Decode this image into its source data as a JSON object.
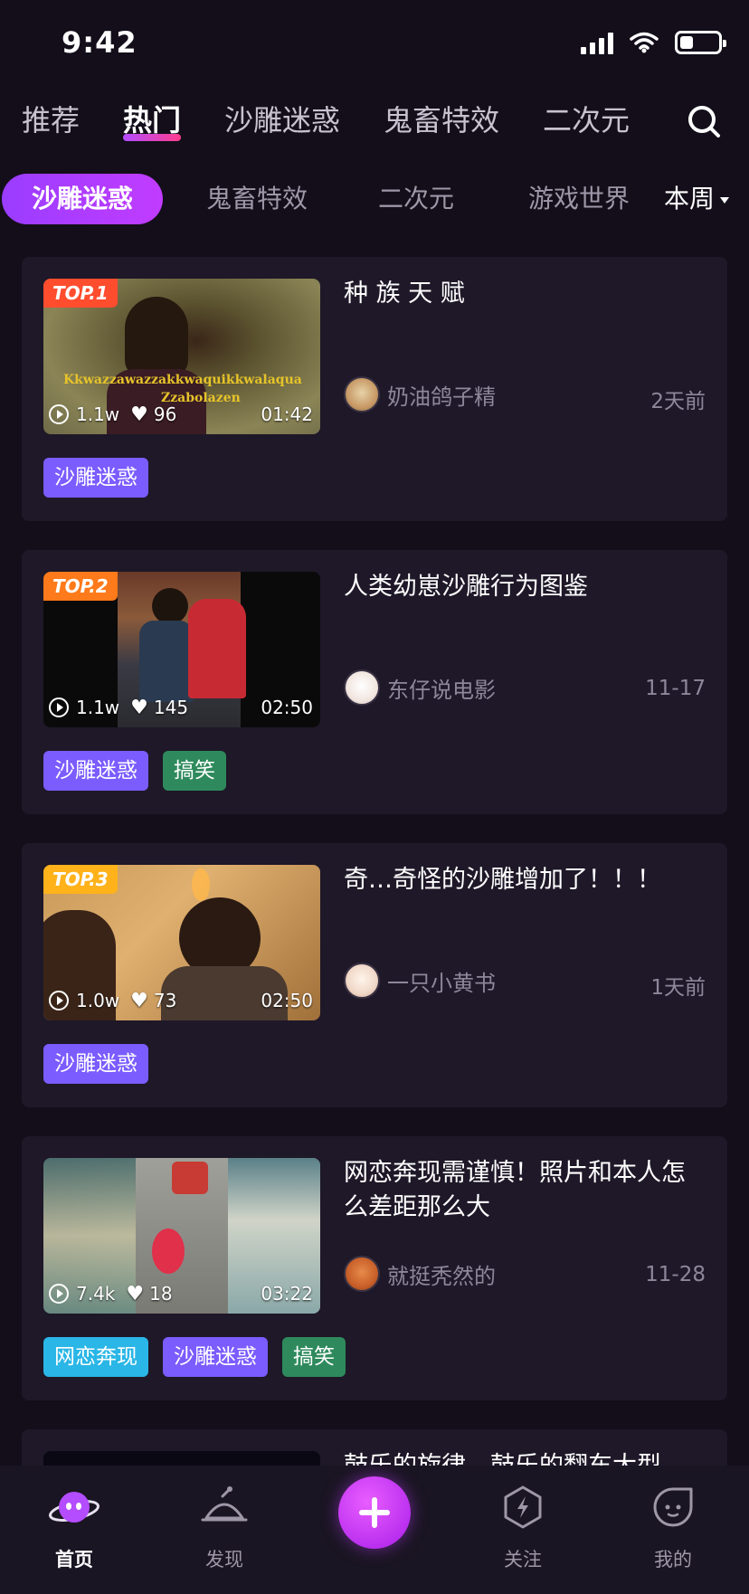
{
  "status_bar": {
    "time": "9:42"
  },
  "top_tabs": [
    {
      "label": "推荐"
    },
    {
      "label": "热门"
    },
    {
      "label": "沙雕迷惑"
    },
    {
      "label": "鬼畜特效"
    },
    {
      "label": "二次元"
    }
  ],
  "sub_tabs": [
    {
      "label": "沙雕迷惑"
    },
    {
      "label": "鬼畜特效"
    },
    {
      "label": "二次元"
    },
    {
      "label": "游戏世界"
    }
  ],
  "period": "本周",
  "videos": [
    {
      "rank": "TOP.1",
      "title": "种 族 天 赋",
      "plays": "1.1w",
      "likes": "96",
      "duration": "01:42",
      "caption": "Kkwazzawazzakkwaquikkwalaqua\nZzabolazen",
      "author": "奶油鸽子精",
      "date": "2天前",
      "tags": [
        "沙雕迷惑"
      ]
    },
    {
      "rank": "TOP.2",
      "title": "人类幼崽沙雕行为图鉴",
      "plays": "1.1w",
      "likes": "145",
      "duration": "02:50",
      "author": "东仔说电影",
      "date": "11-17",
      "tags": [
        "沙雕迷惑",
        "搞笑"
      ]
    },
    {
      "rank": "TOP.3",
      "title": "奇…奇怪的沙雕增加了！！！",
      "plays": "1.0w",
      "likes": "73",
      "duration": "02:50",
      "author": "一只小黄书",
      "date": "1天前",
      "tags": [
        "沙雕迷惑"
      ]
    },
    {
      "rank": "",
      "title": "网恋奔现需谨慎！照片和本人怎么差距那么大",
      "plays": "7.4k",
      "likes": "18",
      "duration": "03:22",
      "author": "就挺秃然的",
      "date": "11-28",
      "tags": [
        "网恋奔现",
        "沙雕迷惑",
        "搞笑"
      ]
    },
    {
      "title": "鼓乐的旋律，鼓乐的翻车大型"
    }
  ],
  "tag_colors": {
    "沙雕迷惑": "#7a5cff",
    "搞笑": "#2e8a5c",
    "网恋奔现": "#2ab6e6"
  },
  "rank_colors": [
    "#ff4d2e",
    "#ff7a1a",
    "#ffb21a"
  ],
  "bottom_nav": [
    {
      "label": "首页",
      "icon": "planet-icon"
    },
    {
      "label": "发现",
      "icon": "ufo-icon"
    },
    {
      "label": "",
      "icon": "plus-icon"
    },
    {
      "label": "关注",
      "icon": "bolt-icon"
    },
    {
      "label": "我的",
      "icon": "face-icon"
    }
  ]
}
